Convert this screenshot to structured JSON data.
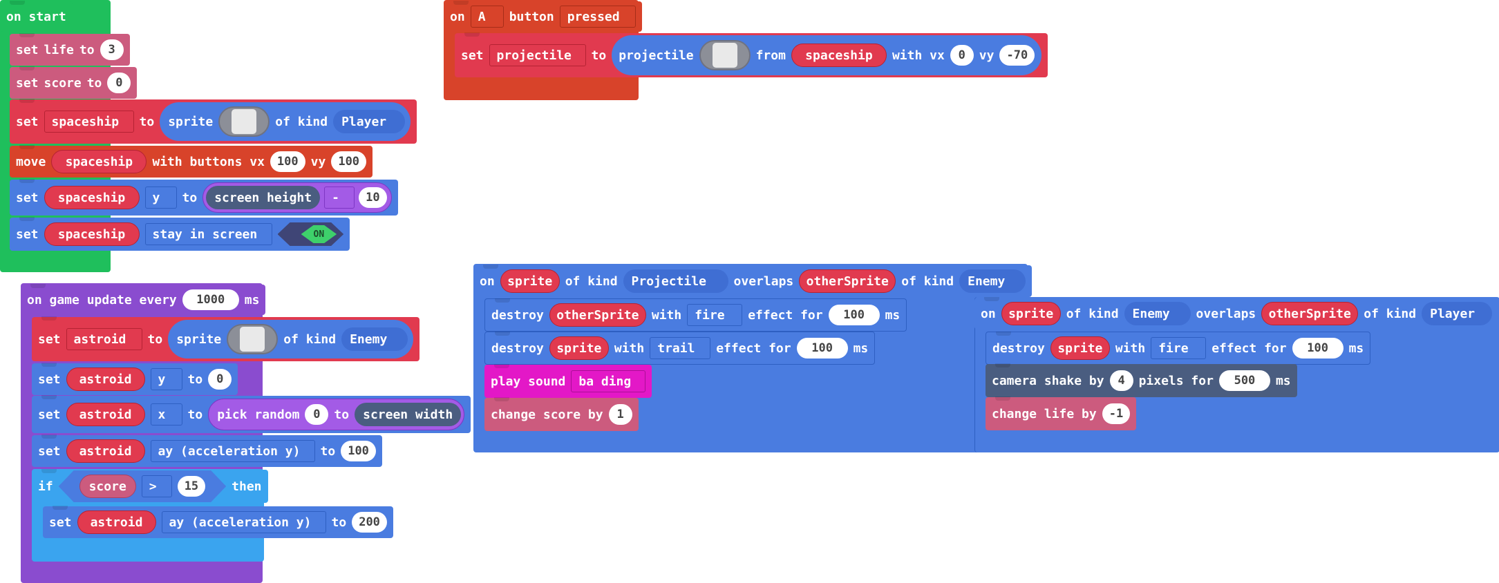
{
  "on_start": {
    "header": "on start",
    "set_life": {
      "set": "set",
      "var": "life",
      "to": "to",
      "value": "3"
    },
    "set_score": {
      "set": "set",
      "var": "score",
      "to": "to",
      "value": "0"
    },
    "set_spaceship": {
      "set": "set",
      "var": "spaceship",
      "to": "to",
      "sprite": "sprite",
      "of_kind": "of kind",
      "kind": "Player"
    },
    "move": {
      "move": "move",
      "sprite": "spaceship",
      "with_buttons": "with buttons vx",
      "vx": "100",
      "vy_label": "vy",
      "vy": "100"
    },
    "set_y": {
      "set": "set",
      "sprite": "spaceship",
      "prop": "y",
      "to": "to",
      "screen_height": "screen height",
      "op": "-",
      "value": "10"
    },
    "set_stay": {
      "set": "set",
      "sprite": "spaceship",
      "flag": "stay in screen",
      "toggle": "ON"
    }
  },
  "on_a_pressed": {
    "on": "on",
    "button": "A",
    "button_label": "button",
    "event": "pressed",
    "set": "set",
    "var": "projectile",
    "to": "to",
    "projectile_label": "projectile",
    "from": "from",
    "sprite": "spaceship",
    "with_vx": "with vx",
    "vx": "0",
    "vy_label": "vy",
    "vy": "-70"
  },
  "on_game_update": {
    "header": "on game update every",
    "interval": "1000",
    "unit": "ms",
    "set_astroid": {
      "set": "set",
      "var": "astroid",
      "to": "to",
      "sprite": "sprite",
      "of_kind": "of kind",
      "kind": "Enemy"
    },
    "set_y": {
      "set": "set",
      "sprite": "astroid",
      "prop": "y",
      "to": "to",
      "value": "0"
    },
    "set_x": {
      "set": "set",
      "sprite": "astroid",
      "prop": "x",
      "to": "to",
      "pick_random": "pick random",
      "from": "0",
      "to2": "to",
      "screen_width": "screen width"
    },
    "set_ay": {
      "set": "set",
      "sprite": "astroid",
      "prop": "ay (acceleration y)",
      "to": "to",
      "value": "100"
    },
    "if_block": {
      "if": "if",
      "var": "score",
      "op": ">",
      "value": "15",
      "then": "then"
    },
    "set_ay2": {
      "set": "set",
      "sprite": "astroid",
      "prop": "ay (acceleration y)",
      "to": "to",
      "value": "200"
    }
  },
  "overlap_projectile": {
    "on": "on",
    "sprite": "sprite",
    "of_kind": "of kind",
    "kind": "Projectile",
    "overlaps": "overlaps",
    "other": "otherSprite",
    "of_kind2": "of kind",
    "kind2": "Enemy",
    "destroy1": {
      "destroy": "destroy",
      "sprite": "otherSprite",
      "with": "with",
      "effect": "fire",
      "effect_for": "effect for",
      "ms_value": "100",
      "ms": "ms"
    },
    "destroy2": {
      "destroy": "destroy",
      "sprite": "sprite",
      "with": "with",
      "effect": "trail",
      "effect_for": "effect for",
      "ms_value": "100",
      "ms": "ms"
    },
    "play_sound": {
      "label": "play sound",
      "sound": "ba ding"
    },
    "change_score": {
      "label": "change score by",
      "value": "1"
    }
  },
  "overlap_enemy": {
    "on": "on",
    "sprite": "sprite",
    "of_kind": "of kind",
    "kind": "Enemy",
    "overlaps": "overlaps",
    "other": "otherSprite",
    "of_kind2": "of kind",
    "kind2": "Player",
    "destroy": {
      "destroy": "destroy",
      "sprite": "sprite",
      "with": "with",
      "effect": "fire",
      "effect_for": "effect for",
      "ms_value": "100",
      "ms": "ms"
    },
    "camera": {
      "label": "camera shake by",
      "value": "4",
      "pixels_for": "pixels for",
      "ms_value": "500",
      "ms": "ms"
    },
    "change_life": {
      "label": "change life by",
      "value": "-1"
    }
  },
  "colors": {
    "event_green": "#1fbf5c",
    "orange": "#d8432a",
    "pink": "#cc5b7e",
    "red": "#e13a4f",
    "blue": "#4a7ce0",
    "purple": "#8a4ccf",
    "light_blue": "#3aa4ef",
    "magenta": "#e318c7",
    "slate": "#4a5d80"
  }
}
